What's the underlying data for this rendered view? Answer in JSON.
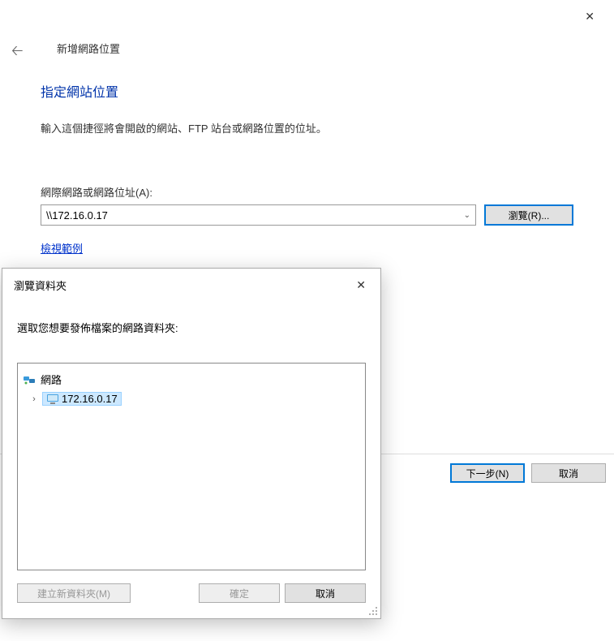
{
  "main": {
    "title": "新增網路位置",
    "heading": "指定網站位置",
    "instruction": "輸入這個捷徑將會開啟的網站、FTP 站台或網路位置的位址。",
    "address_label": "網際網路或網路位址(A):",
    "address_value": "\\\\172.16.0.17",
    "browse_button": "瀏覽(R)...",
    "example_link": "檢視範例",
    "next_button": "下一步(N)",
    "cancel_button": "取消"
  },
  "dialog": {
    "title": "瀏覽資料夾",
    "instruction": "選取您想要發佈檔案的網路資料夾:",
    "tree_root": "網路",
    "tree_item": "172.16.0.17",
    "new_folder_button": "建立新資料夾(M)",
    "ok_button": "確定",
    "cancel_button": "取消"
  }
}
